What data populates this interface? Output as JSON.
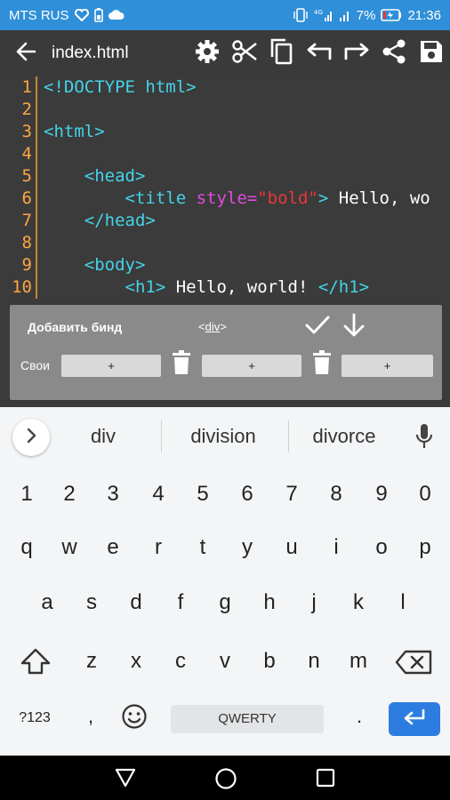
{
  "status_bar": {
    "carrier": "MTS RUS",
    "battery_percent": "7%",
    "time": "21:36",
    "signal_label": "4G"
  },
  "toolbar": {
    "title": "index.html",
    "icons": [
      "back-arrow-icon",
      "gear-icon",
      "scissors-icon",
      "copy-icon",
      "undo-icon",
      "redo-icon",
      "share-icon",
      "save-icon"
    ]
  },
  "editor": {
    "line_numbers": [
      "1",
      "2",
      "3",
      "4",
      "5",
      "6",
      "7",
      "8",
      "9",
      "10"
    ],
    "lines": [
      {
        "t1": "<!DOCTYPE html>"
      },
      {
        "t1": ""
      },
      {
        "t1": "<html>"
      },
      {
        "t1": ""
      },
      {
        "t1": "    <head>"
      },
      {
        "t1": "        <title ",
        "attr": "style=",
        "str": "\"bold\"",
        "t2": ">",
        "text": " Hello, wo"
      },
      {
        "t1": "    </head>"
      },
      {
        "t1": ""
      },
      {
        "t1": "    <body>"
      },
      {
        "t1": "        <h1>",
        "text": " Hello, world! ",
        "t2": "</h1>"
      }
    ],
    "colors": {
      "gutter": "#ffa640",
      "tag": "#44d3e8",
      "attr": "#e24ae0",
      "string": "#e83838"
    }
  },
  "bind_panel": {
    "title": "Добавить бинд",
    "tag_open": "<",
    "tag_name": "div",
    "tag_close": ">",
    "own_label": "Свои",
    "slots": [
      "+",
      "+",
      "+"
    ]
  },
  "keyboard": {
    "suggestions": [
      "div",
      "division",
      "divorce"
    ],
    "numbers": [
      "1",
      "2",
      "3",
      "4",
      "5",
      "6",
      "7",
      "8",
      "9",
      "0"
    ],
    "row1": [
      "q",
      "w",
      "e",
      "r",
      "t",
      "y",
      "u",
      "i",
      "o",
      "p"
    ],
    "row2": [
      "a",
      "s",
      "d",
      "f",
      "g",
      "h",
      "j",
      "k",
      "l"
    ],
    "row3": [
      "z",
      "x",
      "c",
      "v",
      "b",
      "n",
      "m"
    ],
    "symbols_label": "?123",
    "comma": ",",
    "space_label": "QWERTY",
    "period": ".",
    "accent_color": "#2d7de0"
  }
}
